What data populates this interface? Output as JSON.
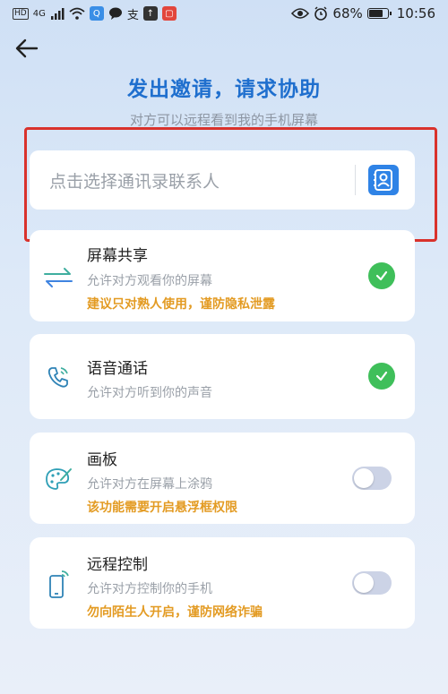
{
  "status_bar": {
    "hd": "HD",
    "network": "4G",
    "battery": "68%",
    "time": "10:56"
  },
  "header": {
    "title": "发出邀请，请求协助",
    "subtitle": "对方可以远程看到我的手机屏幕"
  },
  "contact_picker": {
    "placeholder": "点击选择通讯录联系人"
  },
  "permissions": [
    {
      "title": "屏幕共享",
      "desc": "允许对方观看你的屏幕",
      "warning": "建议只对熟人使用，谨防隐私泄露",
      "enabled": true,
      "icon": "screen-share-icon"
    },
    {
      "title": "语音通话",
      "desc": "允许对方听到你的声音",
      "warning": "",
      "enabled": true,
      "icon": "phone-icon"
    },
    {
      "title": "画板",
      "desc": "允许对方在屏幕上涂鸦",
      "warning": "该功能需要开启悬浮框权限",
      "enabled": false,
      "icon": "palette-icon"
    },
    {
      "title": "远程控制",
      "desc": "允许对方控制你的手机",
      "warning": "勿向陌生人开启，谨防网络诈骗",
      "enabled": false,
      "icon": "remote-control-icon"
    }
  ],
  "colors": {
    "accent": "#1f6fce",
    "warning": "#e39b23",
    "check": "#3fbf5a",
    "highlight": "#d9322c"
  }
}
